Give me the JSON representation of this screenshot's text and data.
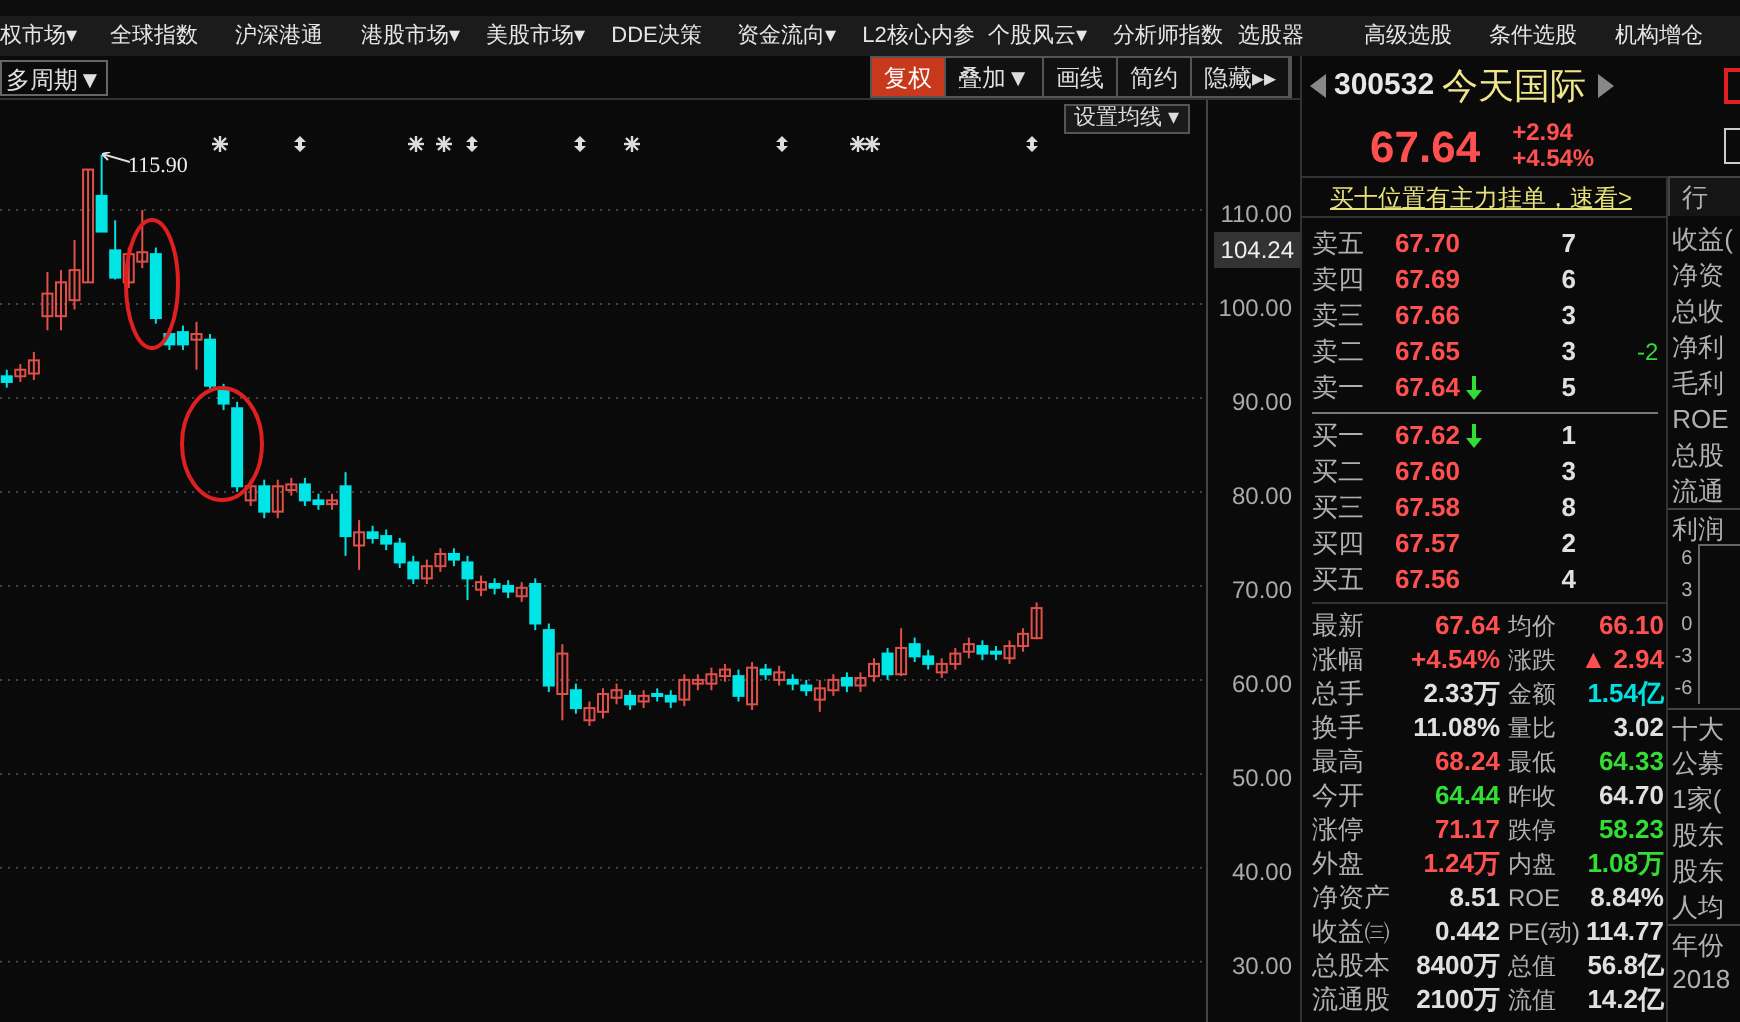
{
  "menu": [
    "权市场▾",
    "全球指数",
    "沪深港通",
    "港股市场▾",
    "美股市场▾",
    "DDE决策",
    "资金流向▾",
    "L2核心内参",
    "个股风云▾",
    "分析师指数",
    "选股器",
    "高级选股",
    "条件选股",
    "机构增仓"
  ],
  "period_button": "多周期▼",
  "toolbar": [
    {
      "label": "复权",
      "selected": true
    },
    {
      "label": "叠加▼",
      "selected": false
    },
    {
      "label": "画线",
      "selected": false
    },
    {
      "label": "简约",
      "selected": false
    },
    {
      "label": "隐藏▸▸",
      "selected": false
    }
  ],
  "chart": {
    "ma_button": "设置均线 ▾",
    "peak_label": "115.90",
    "current_price": "104.24",
    "chart_data": {
      "type": "candlestick",
      "grid": true,
      "ylim": [
        23.6,
        121.7
      ],
      "yticks": [
        {
          "value": 110,
          "label": "110.00"
        },
        {
          "value": 100,
          "label": "100.00"
        },
        {
          "value": 90,
          "label": "90.00"
        },
        {
          "value": 80,
          "label": "80.00"
        },
        {
          "value": 70,
          "label": "70.00"
        },
        {
          "value": 60,
          "label": "60.00"
        },
        {
          "value": 50,
          "label": "50.00"
        },
        {
          "value": 40,
          "label": "40.00"
        },
        {
          "value": 30,
          "label": "30.00"
        }
      ],
      "categories": [
        null,
        null,
        null,
        null,
        null,
        null,
        null,
        null,
        null,
        null,
        null,
        null,
        null,
        null,
        null,
        null,
        null,
        null,
        null,
        null,
        null,
        null,
        null,
        null,
        null,
        null,
        null,
        null,
        null,
        null,
        null,
        null,
        null,
        null,
        null,
        null,
        null,
        null,
        null,
        null,
        null,
        null,
        null,
        null,
        null,
        null,
        null,
        null,
        null,
        null,
        null,
        null,
        null,
        null,
        null,
        null,
        null,
        null,
        null,
        null,
        null,
        null,
        null,
        null,
        null,
        null,
        null,
        null,
        null,
        null,
        null,
        null,
        null,
        null,
        null,
        null,
        null,
        null,
        null,
        null,
        null,
        null,
        null,
        null,
        null,
        null,
        null,
        null,
        null
      ],
      "ohlc": [
        [
          92.3,
          93.0,
          91.1,
          91.7
        ],
        [
          92.3,
          93.6,
          91.7,
          93.0
        ],
        [
          92.6,
          94.9,
          91.9,
          94.0
        ],
        [
          98.7,
          103.4,
          97.2,
          101.1
        ],
        [
          98.7,
          103.6,
          97.2,
          102.3
        ],
        [
          100.4,
          106.8,
          99.4,
          103.6
        ],
        [
          102.3,
          114.3,
          102.3,
          114.3
        ],
        [
          111.5,
          115.9,
          107.7,
          107.7
        ],
        [
          105.7,
          108.9,
          102.6,
          102.8
        ],
        [
          102.3,
          106.0,
          101.7,
          105.3
        ],
        [
          104.5,
          110.0,
          103.8,
          105.5
        ],
        [
          105.3,
          106.0,
          97.9,
          98.5
        ],
        [
          96.8,
          97.4,
          95.1,
          95.7
        ],
        [
          97.0,
          97.7,
          95.1,
          95.7
        ],
        [
          96.2,
          98.1,
          93.0,
          96.8
        ],
        [
          96.2,
          96.8,
          90.6,
          91.3
        ],
        [
          90.8,
          91.5,
          88.7,
          89.4
        ],
        [
          88.9,
          89.6,
          80.0,
          80.6
        ],
        [
          79.1,
          81.3,
          78.5,
          80.6
        ],
        [
          80.6,
          81.3,
          77.2,
          77.9
        ],
        [
          77.9,
          81.3,
          77.2,
          80.6
        ],
        [
          80.2,
          81.5,
          79.6,
          80.8
        ],
        [
          80.8,
          81.5,
          78.5,
          79.1
        ],
        [
          79.1,
          79.8,
          78.1,
          78.7
        ],
        [
          78.7,
          79.8,
          78.1,
          79.1
        ],
        [
          80.6,
          82.1,
          73.2,
          75.3
        ],
        [
          74.3,
          77.0,
          71.7,
          75.7
        ],
        [
          75.7,
          76.4,
          74.5,
          75.1
        ],
        [
          75.3,
          76.0,
          73.8,
          74.5
        ],
        [
          74.5,
          75.1,
          71.9,
          72.5
        ],
        [
          72.5,
          73.2,
          70.2,
          70.8
        ],
        [
          70.8,
          72.8,
          70.2,
          72.1
        ],
        [
          72.1,
          74.0,
          71.5,
          73.4
        ],
        [
          73.4,
          74.0,
          72.1,
          72.8
        ],
        [
          72.5,
          73.2,
          68.5,
          70.8
        ],
        [
          69.6,
          71.1,
          68.9,
          70.4
        ],
        [
          70.2,
          70.8,
          69.1,
          69.8
        ],
        [
          70.0,
          70.6,
          68.7,
          69.4
        ],
        [
          68.9,
          70.4,
          68.3,
          69.8
        ],
        [
          70.2,
          70.8,
          65.3,
          66.0
        ],
        [
          65.3,
          66.0,
          58.7,
          59.4
        ],
        [
          58.5,
          63.8,
          55.7,
          62.8
        ],
        [
          58.9,
          59.6,
          56.4,
          57.0
        ],
        [
          55.7,
          57.7,
          55.1,
          57.0
        ],
        [
          56.6,
          59.1,
          55.9,
          58.5
        ],
        [
          58.1,
          59.6,
          57.4,
          58.9
        ],
        [
          58.3,
          58.9,
          56.8,
          57.4
        ],
        [
          57.7,
          58.9,
          57.0,
          58.3
        ],
        [
          58.5,
          59.1,
          57.7,
          58.3
        ],
        [
          58.3,
          58.9,
          57.0,
          57.7
        ],
        [
          57.9,
          60.6,
          57.2,
          60.0
        ],
        [
          59.6,
          60.6,
          58.9,
          60.0
        ],
        [
          59.6,
          61.3,
          58.9,
          60.6
        ],
        [
          60.4,
          61.7,
          59.8,
          61.1
        ],
        [
          60.4,
          61.1,
          57.7,
          58.3
        ],
        [
          57.4,
          61.9,
          56.8,
          61.3
        ],
        [
          61.1,
          61.7,
          60.0,
          60.6
        ],
        [
          60.0,
          61.5,
          59.4,
          60.8
        ],
        [
          60.0,
          60.6,
          58.9,
          59.6
        ],
        [
          59.4,
          60.0,
          58.3,
          58.9
        ],
        [
          57.9,
          60.0,
          56.6,
          59.1
        ],
        [
          58.9,
          60.6,
          58.3,
          60.0
        ],
        [
          60.2,
          60.8,
          58.7,
          59.4
        ],
        [
          59.4,
          60.8,
          58.7,
          60.2
        ],
        [
          60.4,
          62.3,
          59.8,
          61.7
        ],
        [
          62.8,
          63.4,
          60.0,
          60.6
        ],
        [
          60.6,
          65.5,
          60.4,
          63.4
        ],
        [
          63.8,
          64.5,
          61.9,
          62.5
        ],
        [
          62.5,
          63.2,
          61.1,
          61.7
        ],
        [
          60.8,
          62.3,
          60.2,
          61.7
        ],
        [
          61.7,
          63.4,
          61.1,
          62.8
        ],
        [
          63.0,
          64.5,
          62.3,
          63.8
        ],
        [
          63.6,
          64.2,
          62.1,
          62.8
        ],
        [
          63.0,
          63.6,
          62.1,
          62.8
        ],
        [
          62.3,
          64.2,
          61.7,
          63.6
        ],
        [
          63.6,
          65.5,
          63.0,
          64.9
        ],
        [
          64.44,
          68.24,
          64.33,
          67.64
        ],
        null,
        null,
        null,
        null,
        null,
        null,
        null,
        null,
        null,
        null,
        null,
        null
      ]
    }
  },
  "stock": {
    "code": "300532",
    "name": "今天国际",
    "price": "67.64",
    "change": "+2.94",
    "change_pct": "+4.54%"
  },
  "notice": "买十位置有主力挂单，速看>",
  "asks": [
    {
      "label": "卖五",
      "price": "67.70",
      "arrow": false,
      "volume": "7"
    },
    {
      "label": "卖四",
      "price": "67.69",
      "arrow": false,
      "volume": "6"
    },
    {
      "label": "卖三",
      "price": "67.66",
      "arrow": false,
      "volume": "3"
    },
    {
      "label": "卖二",
      "price": "67.65",
      "arrow": false,
      "volume": "3",
      "delta": "-2"
    },
    {
      "label": "卖一",
      "price": "67.64",
      "arrow": true,
      "volume": "5"
    }
  ],
  "bids": [
    {
      "label": "买一",
      "price": "67.62",
      "arrow": true,
      "volume": "1"
    },
    {
      "label": "买二",
      "price": "67.60",
      "arrow": false,
      "volume": "3"
    },
    {
      "label": "买三",
      "price": "67.58",
      "arrow": false,
      "volume": "8"
    },
    {
      "label": "买四",
      "price": "67.57",
      "arrow": false,
      "volume": "2"
    },
    {
      "label": "买五",
      "price": "67.56",
      "arrow": false,
      "volume": "4"
    }
  ],
  "stats": [
    [
      {
        "label": "最新",
        "value": "67.64",
        "color": "#ff5050"
      },
      {
        "label": "均价",
        "value": "66.10",
        "color": "#ff5050"
      }
    ],
    [
      {
        "label": "涨幅",
        "value": "+4.54%",
        "color": "#ff5050"
      },
      {
        "label": "涨跌",
        "value": "▲ 2.94",
        "color": "#ff5050"
      }
    ],
    [
      {
        "label": "总手",
        "value": "2.33万",
        "color": "#e0e0e0"
      },
      {
        "label": "金额",
        "value": "1.54亿",
        "color": "#00e0e0"
      }
    ],
    [
      {
        "label": "换手",
        "value": "11.08%",
        "color": "#e0e0e0"
      },
      {
        "label": "量比",
        "value": "3.02",
        "color": "#e0e0e0"
      }
    ],
    [
      {
        "label": "最高",
        "value": "68.24",
        "color": "#ff5050"
      },
      {
        "label": "最低",
        "value": "64.33",
        "color": "#33dd33"
      }
    ],
    [
      {
        "label": "今开",
        "value": "64.44",
        "color": "#33dd33"
      },
      {
        "label": "昨收",
        "value": "64.70",
        "color": "#e0e0e0"
      }
    ],
    [
      {
        "label": "涨停",
        "value": "71.17",
        "color": "#ff5050"
      },
      {
        "label": "跌停",
        "value": "58.23",
        "color": "#33dd33"
      }
    ],
    [
      {
        "label": "外盘",
        "value": "1.24万",
        "color": "#ff5050"
      },
      {
        "label": "内盘",
        "value": "1.08万",
        "color": "#33dd33"
      }
    ],
    [
      {
        "label": "净资产",
        "value": "8.51",
        "color": "#e0e0e0"
      },
      {
        "label": "ROE",
        "value": "8.84%",
        "color": "#e0e0e0"
      }
    ],
    [
      {
        "label": "收益㈢",
        "value": "0.442",
        "color": "#e0e0e0"
      },
      {
        "label": "PE(动)",
        "value": "114.77",
        "color": "#e0e0e0"
      }
    ],
    [
      {
        "label": "总股本",
        "value": "8400万",
        "color": "#e0e0e0"
      },
      {
        "label": "总值",
        "value": "56.8亿",
        "color": "#e0e0e0"
      }
    ],
    [
      {
        "label": "流通股",
        "value": "2100万",
        "color": "#e0e0e0"
      },
      {
        "label": "流值",
        "value": "14.2亿",
        "color": "#e0e0e0"
      }
    ]
  ],
  "side": {
    "tab": "行",
    "metrics": [
      "收益(",
      "净资",
      "总收",
      "净利",
      "毛利",
      "ROE",
      "总股",
      "流通"
    ],
    "profit_title": "利润",
    "profit_ticks": [
      "6",
      "3",
      "0",
      "-3",
      "-6"
    ],
    "holders_title": "十大",
    "holders": [
      "公募",
      "1家(",
      "股东",
      "股东",
      "人均"
    ],
    "year_title": "年份",
    "year": "2018"
  }
}
